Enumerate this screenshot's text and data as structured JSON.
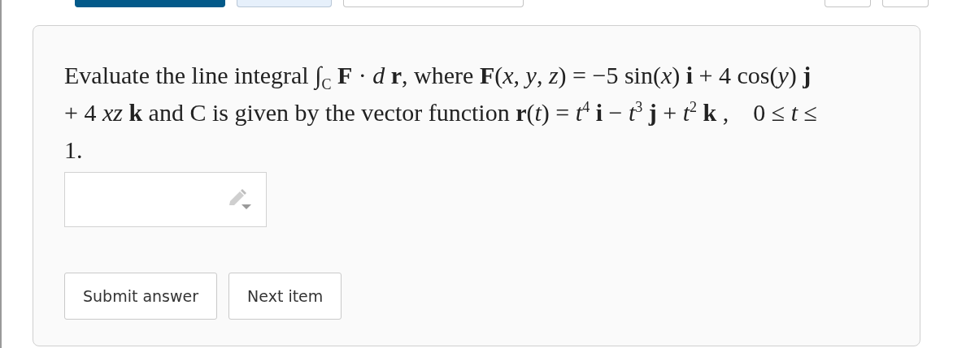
{
  "top_controls": [
    {
      "kind": "primary"
    },
    {
      "kind": "secondary"
    },
    {
      "kind": "outline"
    },
    {
      "kind": "spacer"
    },
    {
      "kind": "outline-small"
    },
    {
      "kind": "outline-small"
    }
  ],
  "question": "Evaluate the line integral ∫$_{C}$ **F** · *d* **r**, where **F**(*x*, *y*, *z*) = −5 sin(*x*) **i** + 4 cos(*y*) **j** + 4 *xz* **k** and C is given by the vector function **r**(*t*) = *t*$^{4}$ **i** − *t*$^{3}$ **j** + *t*$^{2}$ **k** ,    0 ≤ *t* ≤ 1.",
  "buttons": [
    {
      "label": "Submit answer"
    },
    {
      "label": "Next item"
    }
  ]
}
